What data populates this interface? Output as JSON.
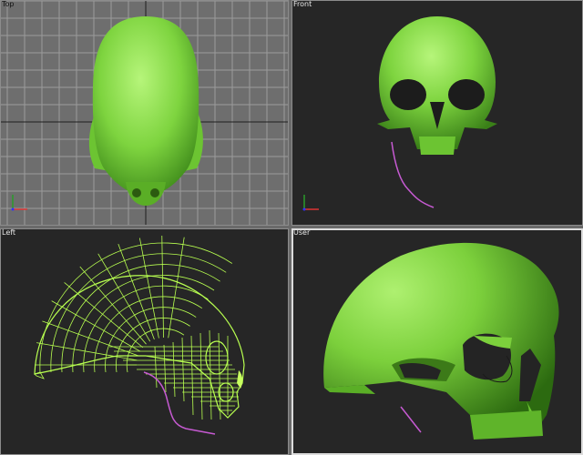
{
  "viewports": {
    "top": {
      "label": "Top"
    },
    "front": {
      "label": "Front"
    },
    "left": {
      "label": "Left"
    },
    "user": {
      "label": "User"
    }
  },
  "colors": {
    "skull": "#86e04a",
    "wire": "#b8ff50",
    "spline": "#c65ad2",
    "grid_top": "#9a9a9a",
    "grid_dark": "#3a3a3a",
    "active_border": "#dcdcdc"
  },
  "icons": [
    "axis-tripod-icon"
  ]
}
